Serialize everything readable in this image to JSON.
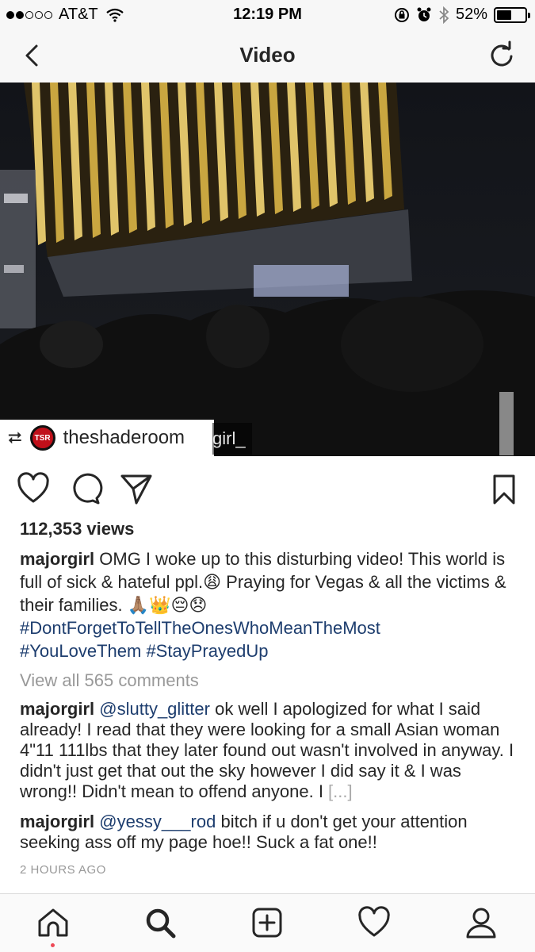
{
  "status_bar": {
    "carrier": "AT&T",
    "time": "12:19 PM",
    "battery": "52%",
    "battery_level": 0.52
  },
  "nav": {
    "title": "Video"
  },
  "video": {
    "repost_label": "theshaderoom",
    "repost_avatar_text": "TSR",
    "overflow_text": "girl_"
  },
  "post": {
    "views": "112,353 views",
    "caption": {
      "user": "majorgirl",
      "text": " OMG I woke up to this disturbing video! This world is full of sick & hateful ppl.😩 Praying  for Vegas & all the victims & their families. 🙏🏽👑😔😞",
      "hashtag1": "#DontForgetToTellTheOnesWhoMeanTheMost",
      "hashtag2": "#YouLoveThem",
      "hashtag3": "#StayPrayedUp"
    },
    "view_all": "View all 565 comments",
    "comments": [
      {
        "user": "majorgirl",
        "mention": "@slutty_glitter",
        "text": " ok well I apologized for what I said already! I read that they were looking for a small Asian woman 4\"11 111lbs that they later found out wasn't involved in anyway. I didn't just get that out the sky however I did say it & I was wrong!! Didn't mean to offend anyone. I ",
        "more": "[...]"
      },
      {
        "user": "majorgirl",
        "mention": "@yessy___rod",
        "text": " bitch if u don't get your attention seeking ass off my page hoe!! Suck a fat one!!"
      }
    ],
    "time_ago": "2 HOURS AGO"
  },
  "icons": {
    "back": "chevron-left-icon",
    "refresh": "refresh-icon",
    "like": "heart-icon",
    "comment": "comment-icon",
    "share": "share-icon",
    "save": "bookmark-icon",
    "home": "home-icon",
    "search": "search-icon",
    "add": "add-icon",
    "activity": "heart-icon",
    "profile": "profile-icon"
  },
  "colors": {
    "hashtag": "#1d3d6e",
    "muted": "#999999",
    "notification_dot": "#ed4956"
  }
}
